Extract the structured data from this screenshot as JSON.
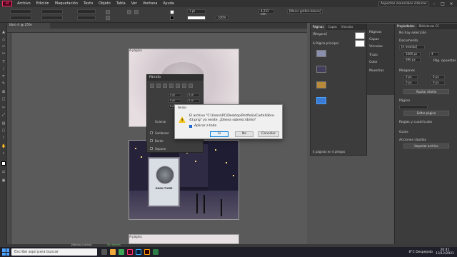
{
  "menubar": {
    "logo": "Id",
    "items": [
      "Archivo",
      "Edición",
      "Maquetación",
      "Texto",
      "Objeto",
      "Tabla",
      "Ver",
      "Ventana",
      "Ayuda"
    ],
    "workspace": "Aspectos esenciales clásicos"
  },
  "controlbar": {
    "stroke_weight": "1 pt",
    "zoom": "100%",
    "frame_style": "[Marco gráfico básico]",
    "value_mm": "4,233 mm"
  },
  "document": {
    "tab": "libro 4 @ 25%",
    "page_label_1": "A-página",
    "page_label_2": "A-página",
    "billboard_title": "GRAN TIGRE"
  },
  "paragraph_panel": {
    "title": "Párrafo",
    "values": [
      "0 pt",
      "0 pt",
      "0 pt",
      "0 pt",
      "0 pt",
      "0 pt"
    ],
    "hyphenate_label": "Guionar",
    "sombrear_label": "Sombrear",
    "borde_label": "Borde",
    "separar_label": "Separar"
  },
  "dialog": {
    "title": "Aviso",
    "message": "El archivo \"C:\\Users\\PC\\Desktop\\Portfolio\\Cartel\\libro-43.png\" ya existe. ¿Desea sobrescribirlo?",
    "checkbox_label": "Aplicar a todo",
    "buttons": {
      "yes": "Sí",
      "no": "No",
      "cancel": "Cancelar"
    }
  },
  "pages_panel": {
    "tabs": [
      "Páginas",
      "Capas",
      "Vínculos"
    ],
    "none_label": "[Ninguna]",
    "master_label": "A-Página principal",
    "footer": "4 páginas en 4 pliegos"
  },
  "dock": {
    "items": [
      "Páginas",
      "Capas",
      "Vínculos",
      "Trazo",
      "Color",
      "Muestras"
    ]
  },
  "properties": {
    "tabs": [
      "Propiedades",
      "Bibliotecas CC"
    ],
    "no_selection": "No hay selección",
    "document_label": "Documento",
    "preset": "[A medida]",
    "width": "1060 px",
    "height": "690 px",
    "pages": "4",
    "facing_label": "Pág. opuestas",
    "margins_label": "Márgenes",
    "margin_values": [
      "0 px",
      "0 px",
      "0 px",
      "0 px"
    ],
    "adjust_layout": "Ajustar diseño",
    "page_label": "Página",
    "edit_page": "Editar página",
    "rules_label": "Reglas y cuadrículas",
    "guides_label": "Guías",
    "quick_actions": "Acciones rápidas",
    "import_file": "Importar archivo"
  },
  "statusbar": {
    "master": "[Básico] (activo)",
    "errors": "Sin errores"
  },
  "taskbar": {
    "search_placeholder": "Escribe aquí para buscar",
    "weather": "8°C Despejado",
    "time": "20:41",
    "date": "13/12/2021"
  },
  "colors": {
    "indesign": "#ff3366",
    "dialog_primary": "#0078d7",
    "warning": "#f5c518"
  }
}
